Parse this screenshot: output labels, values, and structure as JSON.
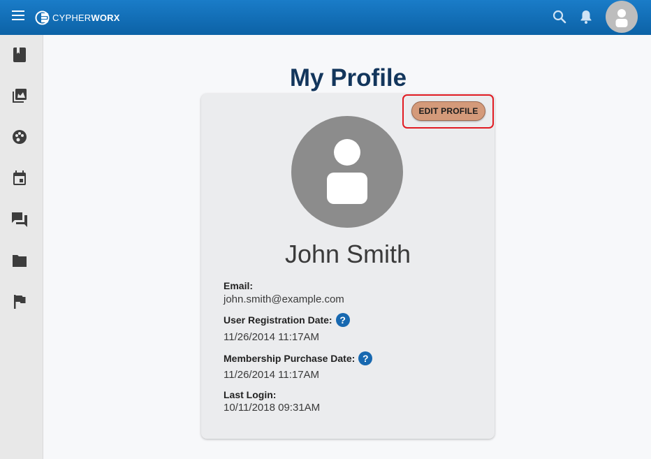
{
  "header": {
    "logo_text_light": "CYPHER",
    "logo_text_bold": "WORX",
    "brand_color": "#0c62a6",
    "icons": [
      "menu-icon",
      "search-icon",
      "bell-icon",
      "user-avatar-icon"
    ]
  },
  "sidebar": {
    "items": [
      {
        "icon": "book-icon"
      },
      {
        "icon": "library-icon"
      },
      {
        "icon": "palette-icon"
      },
      {
        "icon": "calendar-icon"
      },
      {
        "icon": "forum-icon"
      },
      {
        "icon": "folder-icon"
      },
      {
        "icon": "flag-icon"
      }
    ]
  },
  "main": {
    "page_title": "My Profile",
    "edit_button_label": "EDIT PROFILE",
    "highlight_color": "#e11b22",
    "user_name": "John Smith",
    "fields": {
      "email_label": "Email:",
      "email_value": "john.smith@example.com",
      "registration_label": "User Registration Date:",
      "registration_value": "11/26/2014 11:17AM",
      "membership_label": "Membership Purchase Date:",
      "membership_value": "11/26/2014 11:17AM",
      "last_login_label": "Last Login:",
      "last_login_value": "10/11/2018 09:31AM",
      "help_glyph": "?"
    }
  }
}
